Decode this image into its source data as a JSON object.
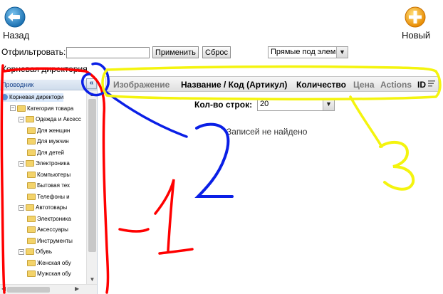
{
  "toolbar": {
    "back_label": "Назад",
    "new_label": "Новый"
  },
  "filter": {
    "label": "Отфильтровать:",
    "value": "",
    "apply_label": "Применить",
    "reset_label": "Сброс",
    "scope_selected": "Прямые под элем"
  },
  "breadcrumb": "Корневая директория",
  "explorer": {
    "title": "Проводник",
    "tree": [
      {
        "label": "Корневая директори",
        "level": 0,
        "type": "root"
      },
      {
        "label": "Категория товара",
        "level": 1,
        "type": "folder"
      },
      {
        "label": "Одежда и Аксесс",
        "level": 2,
        "type": "folder"
      },
      {
        "label": "Для женщин",
        "level": 3,
        "type": "folder"
      },
      {
        "label": "Для мужчин",
        "level": 3,
        "type": "folder"
      },
      {
        "label": "Для детей",
        "level": 3,
        "type": "folder"
      },
      {
        "label": "Электроника",
        "level": 2,
        "type": "folder"
      },
      {
        "label": "Компьютеры",
        "level": 3,
        "type": "folder"
      },
      {
        "label": "Бытовая тех",
        "level": 3,
        "type": "folder"
      },
      {
        "label": "Телефоны и",
        "level": 3,
        "type": "folder"
      },
      {
        "label": "Автотовары",
        "level": 2,
        "type": "folder"
      },
      {
        "label": "Электроника",
        "level": 3,
        "type": "folder"
      },
      {
        "label": "Аксессуары",
        "level": 3,
        "type": "folder"
      },
      {
        "label": "Инструменты",
        "level": 3,
        "type": "folder"
      },
      {
        "label": "Обувь",
        "level": 2,
        "type": "folder"
      },
      {
        "label": "Женская обу",
        "level": 3,
        "type": "folder"
      },
      {
        "label": "Мужская обу",
        "level": 3,
        "type": "folder"
      }
    ]
  },
  "collapse_label": "«",
  "grid": {
    "columns": [
      "Изображение",
      "Название / Код (Артикул)",
      "Количество",
      "Цена",
      "Actions",
      "ID"
    ],
    "rows_label": "Кол-во строк:",
    "rows_value": "20",
    "empty_message": "Записей не найдено"
  },
  "annotations": {
    "red_label": "1",
    "blue_label": "2",
    "yellow_label": "3"
  },
  "colors": {
    "back_button": "#1f86c8",
    "new_button": "#f5a300",
    "red": "#ff0000",
    "blue": "#0a1fe6",
    "yellow": "#f4f40e"
  }
}
